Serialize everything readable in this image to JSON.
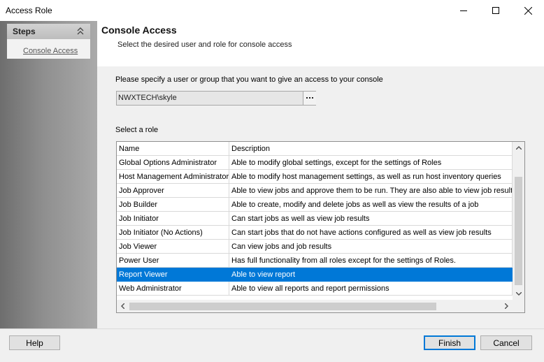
{
  "window": {
    "title": "Access Role"
  },
  "steps": {
    "title": "Steps",
    "items": [
      {
        "label": "Console Access"
      }
    ]
  },
  "header": {
    "title": "Console Access",
    "subtitle": "Select the desired user and role for console access"
  },
  "user": {
    "label": "Please specify a user or group that you want to give an access to your console",
    "value": "NWXTECH\\skyle"
  },
  "roles": {
    "label": "Select a role",
    "columns": {
      "name": "Name",
      "description": "Description"
    },
    "selected_index": 8,
    "selection_color": "#0078d7",
    "rows": [
      {
        "name": "Global Options Administrator",
        "description": "Able to modify global settings, except for the settings of Roles"
      },
      {
        "name": "Host Management Administrator",
        "description": "Able to modify host management settings, as well as run host inventory queries"
      },
      {
        "name": "Job Approver",
        "description": "Able to view jobs and approve them to be run.  They are also able to view job result"
      },
      {
        "name": "Job Builder",
        "description": "Able to create, modify and delete jobs as well as view the results of a job"
      },
      {
        "name": "Job Initiator",
        "description": "Can start jobs as well as view job results"
      },
      {
        "name": "Job Initiator (No Actions)",
        "description": "Can start jobs that do not have actions configured as well as view job results"
      },
      {
        "name": "Job Viewer",
        "description": "Can view jobs and job results"
      },
      {
        "name": "Power User",
        "description": "Has full functionality from all roles except for the settings of Roles."
      },
      {
        "name": "Report Viewer",
        "description": "Able to view report"
      },
      {
        "name": "Web Administrator",
        "description": "Able to view all reports and report permissions"
      }
    ]
  },
  "footer": {
    "help_label": "Help",
    "finish_label": "Finish",
    "cancel_label": "Cancel"
  }
}
